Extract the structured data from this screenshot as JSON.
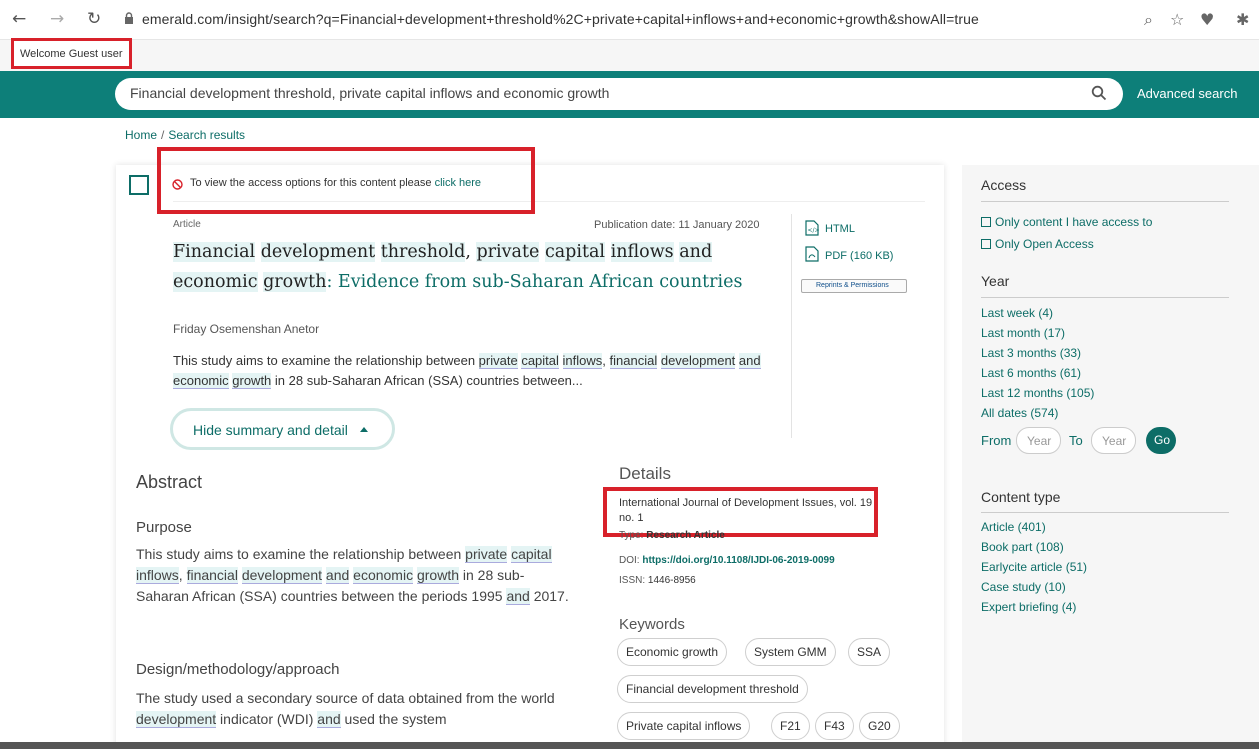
{
  "browser": {
    "url": "emerald.com/insight/search?q=Financial+development+threshold%2C+private+capital+inflows+and+economic+growth&showAll=true"
  },
  "header": {
    "welcome": "Welcome Guest user",
    "search_value": "Financial development threshold, private capital inflows and economic growth",
    "advanced_search": "Advanced search"
  },
  "breadcrumb": {
    "home": "Home",
    "separator": "/",
    "current": "Search results"
  },
  "result": {
    "access_message": "To view the access options for this content please",
    "access_link": "click here",
    "type": "Article",
    "pub_date": "Publication date: 11 January 2020",
    "title_main": [
      {
        "t": "Financial",
        "hl": true
      },
      {
        "t": " ",
        "hl": false
      },
      {
        "t": "development",
        "hl": true
      },
      {
        "t": " ",
        "hl": false
      },
      {
        "t": "threshold",
        "hl": true
      },
      {
        "t": ", ",
        "hl": false
      },
      {
        "t": "private",
        "hl": true
      },
      {
        "t": " ",
        "hl": false
      },
      {
        "t": "capital",
        "hl": true
      },
      {
        "t": " ",
        "hl": false
      },
      {
        "t": "inflows",
        "hl": true
      },
      {
        "t": " ",
        "hl": false
      },
      {
        "t": "and",
        "hl": true
      },
      {
        "t": " ",
        "hl": false
      },
      {
        "t": "economic",
        "hl": true
      },
      {
        "t": " ",
        "hl": false
      },
      {
        "t": "growth",
        "hl": true
      }
    ],
    "title_sub": ": Evidence from sub-Saharan African countries",
    "html_label": "HTML",
    "pdf_label": "PDF (160 KB)",
    "reprints_label": "Reprints & Permissions",
    "author": "Friday Osemenshan Anetor",
    "summary": [
      {
        "t": "This study aims to examine the relationship between ",
        "hl": false
      },
      {
        "t": "private",
        "hl": true
      },
      {
        "t": " ",
        "hl": false
      },
      {
        "t": "capital",
        "hl": true
      },
      {
        "t": " ",
        "hl": false
      },
      {
        "t": "inflows",
        "hl": true
      },
      {
        "t": ", ",
        "hl": false
      },
      {
        "t": "financial",
        "hl": true
      },
      {
        "t": " ",
        "hl": false
      },
      {
        "t": "development",
        "hl": true
      },
      {
        "t": " ",
        "hl": false
      },
      {
        "t": "and",
        "hl": true
      },
      {
        "t": " ",
        "hl": false
      },
      {
        "t": "economic",
        "hl": true
      },
      {
        "t": " ",
        "hl": false
      },
      {
        "t": "growth",
        "hl": true
      },
      {
        "t": " in 28 sub-Saharan African (SSA) countries between...",
        "hl": false
      }
    ],
    "hide_label": "Hide summary and detail",
    "abstract_heading": "Abstract",
    "purpose_heading": "Purpose",
    "purpose_text": [
      {
        "t": "This study aims to examine the relationship between ",
        "hl": false
      },
      {
        "t": "private",
        "hl": true
      },
      {
        "t": " ",
        "hl": false
      },
      {
        "t": "capital",
        "hl": true
      },
      {
        "t": " ",
        "hl": false
      },
      {
        "t": "inflows",
        "hl": true
      },
      {
        "t": ", ",
        "hl": false
      },
      {
        "t": "financial",
        "hl": true
      },
      {
        "t": " ",
        "hl": false
      },
      {
        "t": "development",
        "hl": true
      },
      {
        "t": " ",
        "hl": false
      },
      {
        "t": "and",
        "hl": true
      },
      {
        "t": " ",
        "hl": false
      },
      {
        "t": "economic",
        "hl": true
      },
      {
        "t": " ",
        "hl": false
      },
      {
        "t": "growth",
        "hl": true
      },
      {
        "t": " in 28 sub-Saharan African (SSA) countries between the periods 1995 ",
        "hl": false
      },
      {
        "t": "and",
        "hl": true
      },
      {
        "t": " 2017.",
        "hl": false
      }
    ],
    "design_heading": "Design/methodology/approach",
    "design_text": [
      {
        "t": "The study used a secondary source of data obtained from the world ",
        "hl": false
      },
      {
        "t": "development",
        "hl": true
      },
      {
        "t": " indicator (WDI) ",
        "hl": false
      },
      {
        "t": "and",
        "hl": true
      },
      {
        "t": " used the system",
        "hl": false
      }
    ],
    "details_heading": "Details",
    "journal": "International Journal of Development Issues, vol. 19 no. 1",
    "type_label": "Type:",
    "type_value": "Research Article",
    "doi_label": "DOI:",
    "doi_value": "https://doi.org/10.1108/IJDI-06-2019-0099",
    "issn_label": "ISSN:",
    "issn_value": "1446-8956",
    "keywords_heading": "Keywords",
    "keywords": [
      "Economic growth",
      "System GMM",
      "SSA",
      "Financial development threshold",
      "Private capital inflows",
      "F21",
      "F43",
      "G20"
    ]
  },
  "sidebar": {
    "access_heading": "Access",
    "access_options": [
      "Only content I have access to",
      "Only Open Access"
    ],
    "year_heading": "Year",
    "year_options": [
      "Last week (4)",
      "Last month (17)",
      "Last 3 months (33)",
      "Last 6 months (61)",
      "Last 12 months (105)",
      "All dates (574)"
    ],
    "from_label": "From",
    "to_label": "To",
    "year_placeholder": "Year",
    "go_label": "Go",
    "content_heading": "Content type",
    "content_options": [
      "Article (401)",
      "Book part (108)",
      "Earlycite article (51)",
      "Case study (10)",
      "Expert briefing (4)"
    ]
  },
  "colors": {
    "teal": "#0d7f79",
    "link": "#0d6d67",
    "highlight_box": "#d8212a"
  }
}
